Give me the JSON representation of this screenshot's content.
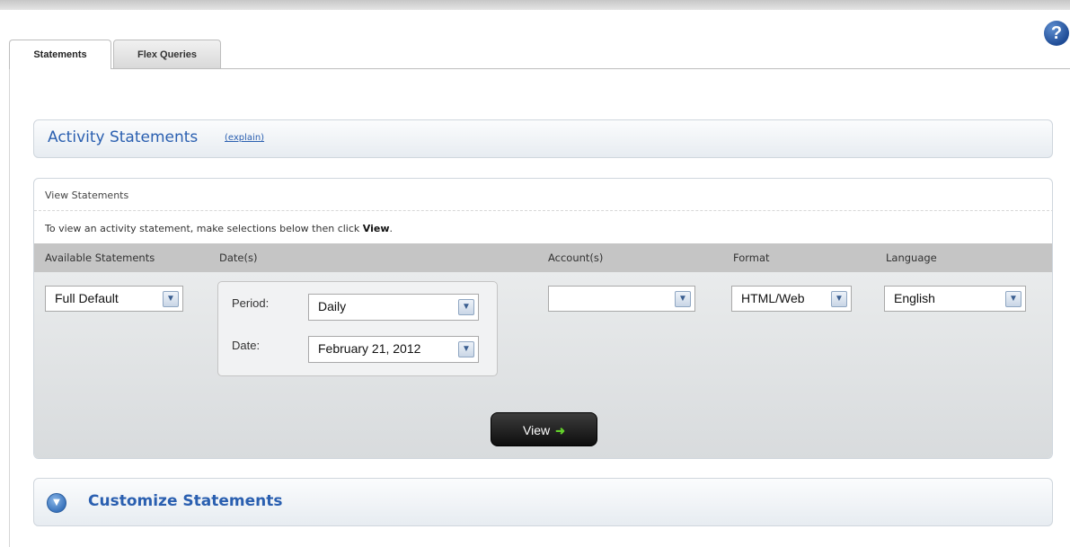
{
  "help": {
    "label": "?"
  },
  "tabs": [
    {
      "label": "Statements",
      "active": true
    },
    {
      "label": "Flex Queries",
      "active": false
    }
  ],
  "activity": {
    "title": "Activity Statements",
    "explain_link": "(explain)"
  },
  "view_statements": {
    "label": "View Statements",
    "instruction_prefix": "To view an activity statement, make selections below then click ",
    "instruction_bold": "View",
    "instruction_suffix": ".",
    "columns": {
      "available": "Available Statements",
      "dates": "Date(s)",
      "accounts": "Account(s)",
      "format": "Format",
      "language": "Language"
    },
    "available_statement": "Full Default",
    "period_label": "Period:",
    "period_value": "Daily",
    "date_label": "Date:",
    "date_value": "February 21, 2012",
    "account_value": "",
    "format_value": "HTML/Web",
    "language_value": "English",
    "view_button": "View"
  },
  "customize": {
    "title": "Customize Statements"
  },
  "icons": {
    "help": "help-icon",
    "dropdown": "chevron-down-icon",
    "arrow": "right-arrow-icon",
    "expand": "expand-circle-icon"
  },
  "colors": {
    "link_blue": "#2a5fb0",
    "button_dark": "#1a1a1a",
    "arrow_green": "#63d12b"
  }
}
